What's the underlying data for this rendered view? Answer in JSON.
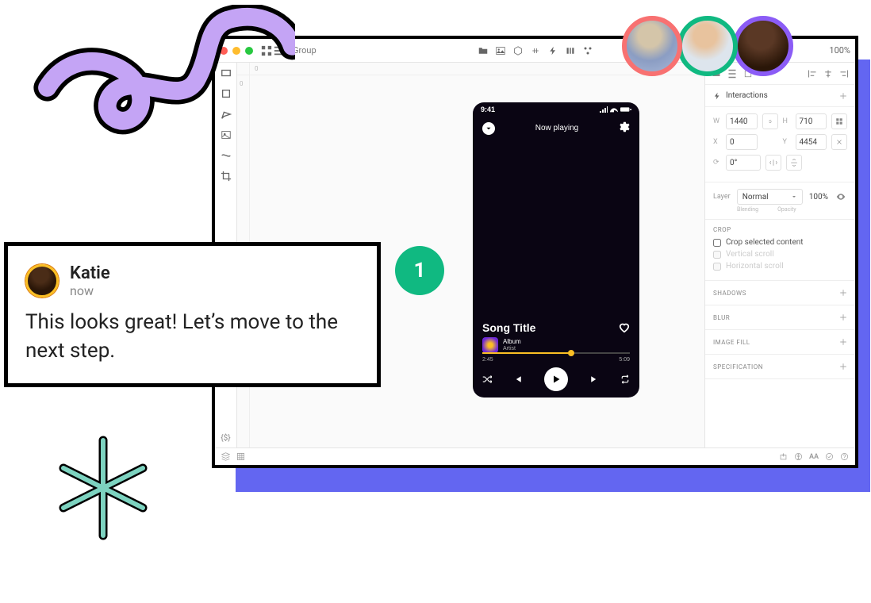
{
  "titlebar": {
    "group_label": "Group",
    "zoom": "100%"
  },
  "canvas": {
    "ruler_marks_h_label": "0",
    "code_token": "{$}"
  },
  "phone": {
    "status_time": "9:41",
    "header": "Now playing",
    "song_title": "Song Title",
    "album_label": "Album",
    "artist_label": "Artist",
    "time_current": "2:45",
    "time_total": "5:09"
  },
  "inspector": {
    "interactions_label": "Interactions",
    "w_label": "W",
    "w_value": "1440",
    "h_label": "H",
    "h_value": "710",
    "x_label": "X",
    "x_value": "0",
    "y_label": "Y",
    "y_value": "4454",
    "rotate_label": "⟳",
    "rotate_value": "0°",
    "layer_label": "Layer",
    "blend_mode": "Normal",
    "opacity": "100%",
    "blend_caption": "Blending",
    "opacity_caption": "Opacity",
    "crop_label": "CROP",
    "crop_selected": "Crop selected content",
    "crop_v": "Vertical scroll",
    "crop_h": "Horizontal scroll",
    "shadows": "SHADOWS",
    "blur": "BLUR",
    "image_fill": "IMAGE FILL",
    "specification": "SPECIFICATION"
  },
  "comment": {
    "name": "Katie",
    "time": "now",
    "body": "This looks great! Let’s move to the next step."
  },
  "badge": {
    "value": "1"
  },
  "statusbar": {
    "aa": "AA"
  }
}
